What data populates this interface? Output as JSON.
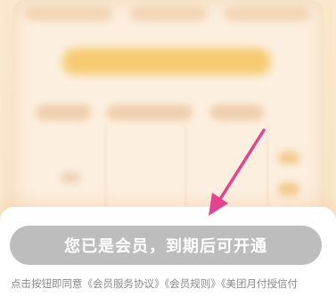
{
  "bottom_sheet": {
    "cta_label": "您已是会员，到期后可开通",
    "agreement": {
      "prefix": "点击按钮即同意",
      "links": [
        "《会员服务协议》",
        "《会员规则》",
        "《美团月付授信付"
      ]
    }
  },
  "icons": {
    "annotation_arrow": "arrow-pointer-icon"
  },
  "colors": {
    "button_disabled_bg": "#bdbdbd",
    "button_text": "#ffffff",
    "annotation": "#e4438f",
    "background": "#fbead2"
  }
}
